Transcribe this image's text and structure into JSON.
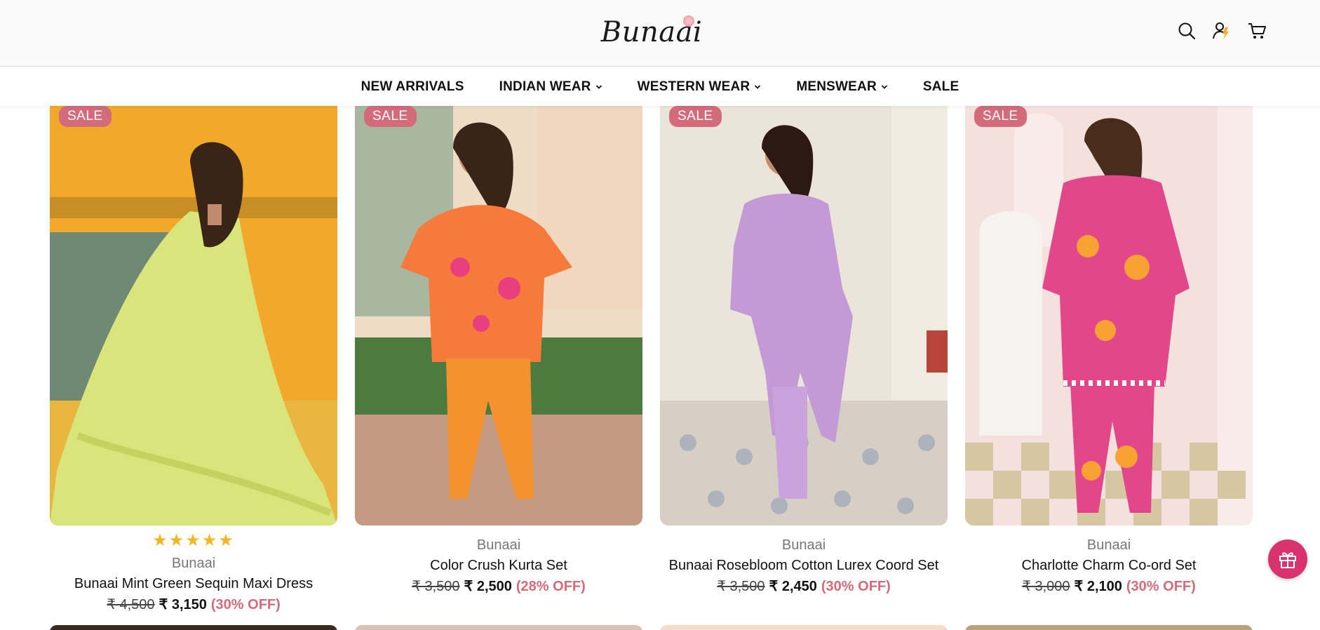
{
  "header": {
    "logo": "Bunaai",
    "icons": [
      "search-icon",
      "account-icon",
      "cart-icon"
    ]
  },
  "nav": [
    {
      "label": "NEW ARRIVALS",
      "dropdown": false
    },
    {
      "label": "INDIAN WEAR",
      "dropdown": true
    },
    {
      "label": "WESTERN WEAR",
      "dropdown": true
    },
    {
      "label": "MENSWEAR",
      "dropdown": true
    },
    {
      "label": "SALE",
      "dropdown": false
    }
  ],
  "products": [
    {
      "badge": "SALE",
      "rating": "★★★★★",
      "brand": "Bunaai",
      "title": "Bunaai Mint Green Sequin Maxi Dress",
      "old_price": "₹ 4,500",
      "new_price": "₹ 3,150",
      "discount": "(30% OFF)",
      "colors": {
        "bg": "#f2a92b",
        "garment": "#d9e47a"
      }
    },
    {
      "badge": "SALE",
      "brand": "Bunaai",
      "title": "Color Crush Kurta Set",
      "old_price": "₹ 3,500",
      "new_price": "₹ 2,500",
      "discount": "(28% OFF)",
      "colors": {
        "bg": "#e9d3c0",
        "garment": "#f57a3b"
      }
    },
    {
      "badge": "SALE",
      "brand": "Bunaai",
      "title": "Bunaai Rosebloom Cotton Lurex Coord Set",
      "old_price": "₹ 3,500",
      "new_price": "₹ 2,450",
      "discount": "(30% OFF)",
      "colors": {
        "bg": "#ebe4d8",
        "garment": "#c39ad6"
      }
    },
    {
      "badge": "SALE",
      "brand": "Bunaai",
      "title": "Charlotte Charm Co-ord Set",
      "old_price": "₹ 3,000",
      "new_price": "₹ 2,100",
      "discount": "(30% OFF)",
      "colors": {
        "bg": "#f4e1de",
        "garment": "#e2478a"
      }
    }
  ],
  "floating": {
    "icon": "gift-icon",
    "accent": "#d8336f"
  }
}
